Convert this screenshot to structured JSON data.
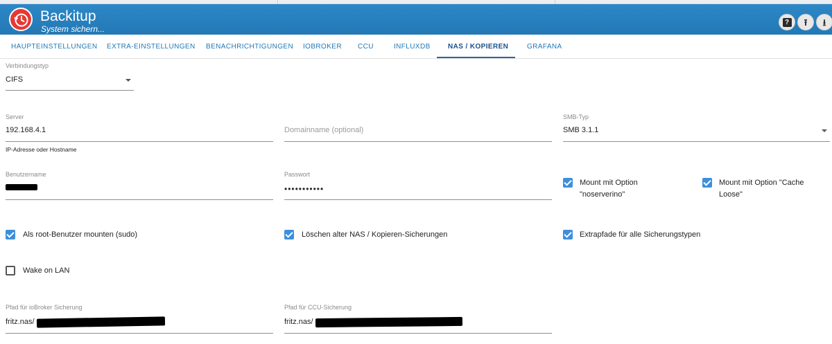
{
  "app": {
    "title": "Backitup",
    "subtitle": "System sichern..."
  },
  "header_buttons": [
    {
      "name": "help-button",
      "icon": "question-icon"
    },
    {
      "name": "upload-button",
      "icon": "upload-icon"
    },
    {
      "name": "download-button",
      "icon": "download-icon"
    }
  ],
  "tabs": [
    {
      "label": "HAUPTEINSTELLUNGEN",
      "active": false
    },
    {
      "label": "EXTRA-EINSTELLUNGEN",
      "active": false
    },
    {
      "label": "BENACHRICHTIGUNGEN",
      "active": false
    },
    {
      "label": "IOBROKER",
      "active": false
    },
    {
      "label": "CCU",
      "active": false
    },
    {
      "label": "INFLUXDB",
      "active": false
    },
    {
      "label": "NAS / KOPIEREN",
      "active": true
    },
    {
      "label": "GRAFANA",
      "active": false
    }
  ],
  "form": {
    "connection_type": {
      "label": "Verbindungstyp",
      "value": "CIFS"
    },
    "server": {
      "label": "Server",
      "value": "192.168.4.1",
      "help": "IP-Adresse oder Hostname"
    },
    "domain": {
      "placeholder": "Domainname (optional)"
    },
    "smb_type": {
      "label": "SMB-Typ",
      "value": "SMB 3.1.1"
    },
    "username": {
      "label": "Benutzername"
    },
    "password": {
      "label": "Passwort",
      "value": "•••••••••••"
    },
    "checkboxes": {
      "noserverino": {
        "label_line1": "Mount mit Option",
        "label_line2": "\"noserverino\"",
        "checked": true
      },
      "cache_loose": {
        "label_line1": "Mount mit Option \"Cache",
        "label_line2": "Loose\"",
        "checked": true
      },
      "sudo": {
        "label": "Als root-Benutzer mounten (sudo)",
        "checked": true
      },
      "delete_old": {
        "label": "Löschen alter NAS / Kopieren-Sicherungen",
        "checked": true
      },
      "extra_paths": {
        "label": "Extrapfade für alle Sicherungstypen",
        "checked": true
      },
      "wol": {
        "label": "Wake on LAN",
        "checked": false
      }
    },
    "iobroker_path": {
      "label": "Pfad für ioBroker Sicherung",
      "value_prefix": "fritz.nas/"
    },
    "ccu_path": {
      "label": "Pfad für CCU-Sicherung",
      "value_prefix": "fritz.nas/"
    }
  },
  "colors": {
    "header": "#2378b5",
    "tab_text": "#1f78b4",
    "tab_active": "#2b63a6",
    "checkbox": "#3d8fdd",
    "logo": "#e53935"
  }
}
